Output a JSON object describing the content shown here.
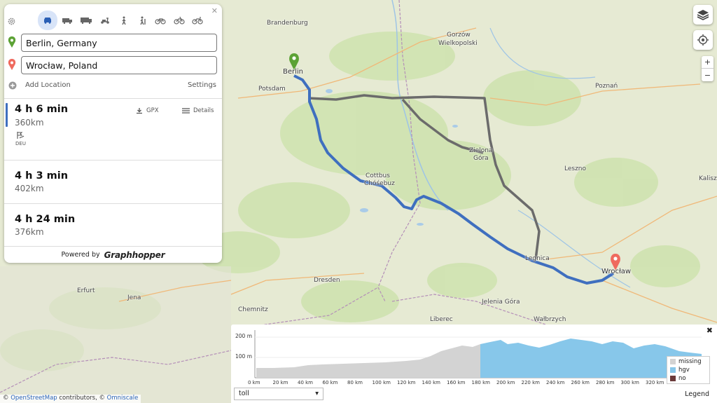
{
  "map": {
    "labels": {
      "brandenburg": "Brandenburg",
      "berlin": "Berlin",
      "potsdam": "Potsdam",
      "gorzow": "Gorzów",
      "wielkopolski": "Wielkopolski",
      "poznan": "Poznań",
      "cottbus": "Cottbus",
      "chosebuz": "Chóśebuz",
      "zielona": "Zielona",
      "gora": "Góra",
      "leszno": "Leszno",
      "kalisz": "Kalisz",
      "legnica": "Legnica",
      "wroclaw": "Wrocław",
      "dresden": "Dresden",
      "erfurt": "Erfurt",
      "jena": "Jena",
      "chemnitz": "Chemnitz",
      "jelenia_gora": "Jelenia Góra",
      "liberec": "Liberec",
      "walbrzych": "Wałbrzych"
    },
    "colors": {
      "selected_route": "#3f6fbf",
      "alt_route": "#6b6b6b",
      "start_pin": "#5ca235",
      "end_pin": "#ef6a5e"
    }
  },
  "panel": {
    "modes": [
      "car-icon",
      "small-truck-icon",
      "truck-icon",
      "scooter-icon",
      "foot-icon",
      "hike-icon",
      "bike-icon",
      "mtb-icon",
      "racingbike-icon"
    ],
    "from": "Berlin, Germany",
    "to": "Wrocław, Poland",
    "add_location": "Add Location",
    "settings": "Settings",
    "routes": [
      {
        "time": "4 h 6 min",
        "distance": "360km",
        "gpx": "GPX",
        "details": "Details",
        "country": "DEU"
      },
      {
        "time": "4 h 3 min",
        "distance": "402km"
      },
      {
        "time": "4 h 24 min",
        "distance": "376km"
      }
    ],
    "powered_by": "Powered by",
    "brand": "Graphhopper"
  },
  "elevation": {
    "y_ticks": [
      "200 m",
      "100 m"
    ],
    "x_ticks": [
      "0 km",
      "20 km",
      "40 km",
      "60 km",
      "80 km",
      "100 km",
      "120 km",
      "140 km",
      "160 km",
      "180 km",
      "200 km",
      "220 km",
      "240 km",
      "260 km",
      "280 km",
      "300 km",
      "320 km"
    ],
    "legend": [
      {
        "label": "missing",
        "color": "#d3d3d3"
      },
      {
        "label": "hgv",
        "color": "#87c7ea"
      },
      {
        "label": "no",
        "color": "#6b3a3a"
      }
    ],
    "select_value": "toll",
    "legend_link": "Legend"
  },
  "attribution": {
    "osm": "OpenStreetMap",
    "contributors": " contributors, © ",
    "omniscale": "Omniscale"
  }
}
